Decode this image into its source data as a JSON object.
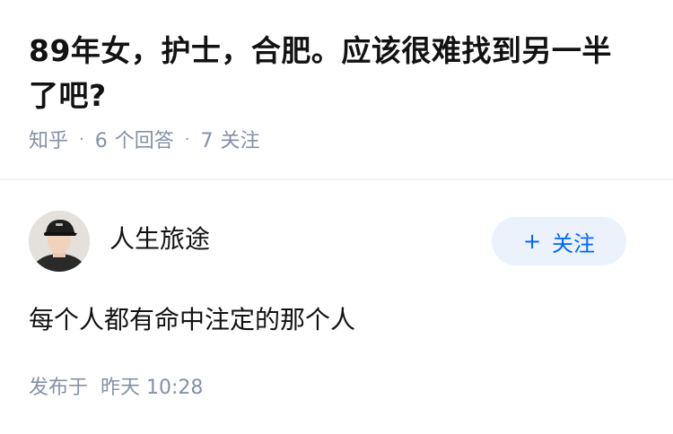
{
  "question": {
    "title": "89年女，护士，合肥。应该很难找到另一半了吧?",
    "source": "知乎",
    "separator": "·",
    "answer_count": "6",
    "answer_label": "个回答",
    "follow_count": "7",
    "follow_label": "关注"
  },
  "answer": {
    "author": "人生旅途",
    "follow_button": {
      "icon": "+",
      "label": "关注"
    },
    "content": "每个人都有命中注定的那个人",
    "publish_prefix": "发布于",
    "publish_time": "昨天 10:28"
  },
  "colors": {
    "text_primary": "#121212",
    "text_secondary": "#8590a6",
    "brand_blue": "#0066ff",
    "button_bg": "#ebf2fc",
    "divider": "#f2f3f5"
  }
}
